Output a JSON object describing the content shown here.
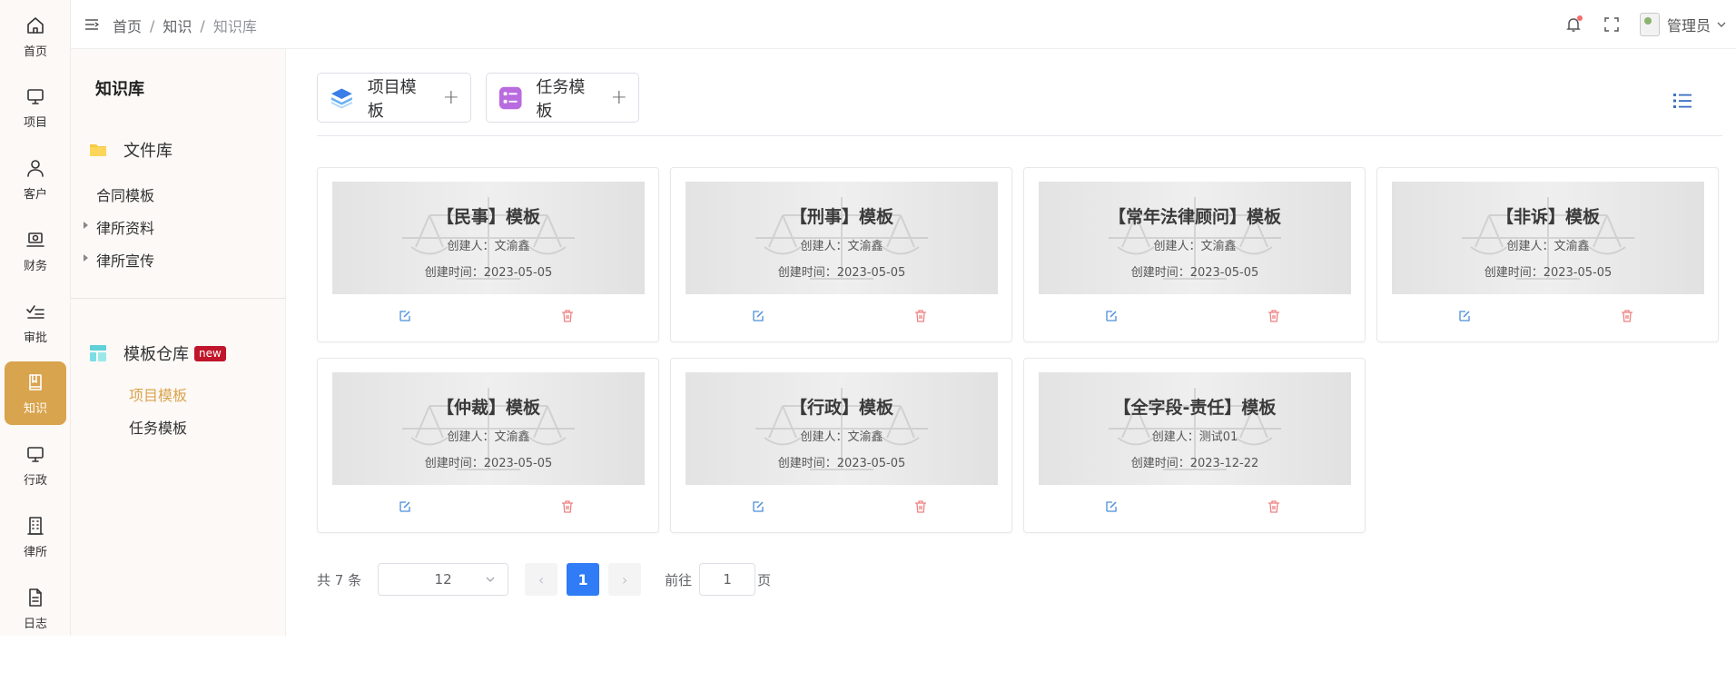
{
  "rail": {
    "items": [
      {
        "label": "首页",
        "icon": "home-icon"
      },
      {
        "label": "项目",
        "icon": "monitor-icon"
      },
      {
        "label": "客户",
        "icon": "user-icon"
      },
      {
        "label": "财务",
        "icon": "finance-icon"
      },
      {
        "label": "审批",
        "icon": "approve-icon"
      },
      {
        "label": "知识",
        "icon": "book-icon",
        "active": true
      },
      {
        "label": "行政",
        "icon": "monitor-icon"
      },
      {
        "label": "律所",
        "icon": "building-icon"
      },
      {
        "label": "日志",
        "icon": "document-icon"
      }
    ],
    "active_color": "#d9a44e"
  },
  "header": {
    "breadcrumbs": [
      "首页",
      "知识",
      "知识库"
    ],
    "separator": "/",
    "user_name": "管理员"
  },
  "sidebar": {
    "title": "知识库",
    "file_library": {
      "label": "文件库",
      "items": [
        {
          "label": "合同模板",
          "expandable": false
        },
        {
          "label": "律所资料",
          "expandable": true
        },
        {
          "label": "律所宣传",
          "expandable": true
        }
      ]
    },
    "template_store": {
      "label": "模板仓库",
      "badge": "new",
      "items": [
        {
          "label": "项目模板",
          "active": true
        },
        {
          "label": "任务模板",
          "active": false
        }
      ]
    }
  },
  "main": {
    "tabs": [
      {
        "label": "项目模板",
        "plus": "+"
      },
      {
        "label": "任务模板",
        "plus": "+"
      }
    ],
    "cards": [
      {
        "name": "【民事】模板",
        "creator": "创建人：文渝鑫",
        "time": "创建时间：2023-05-05"
      },
      {
        "name": "【刑事】模板",
        "creator": "创建人：文渝鑫",
        "time": "创建时间：2023-05-05"
      },
      {
        "name": "【常年法律顾问】模板",
        "creator": "创建人：文渝鑫",
        "time": "创建时间：2023-05-05"
      },
      {
        "name": "【非诉】模板",
        "creator": "创建人：文渝鑫",
        "time": "创建时间：2023-05-05"
      },
      {
        "name": "【仲裁】模板",
        "creator": "创建人：文渝鑫",
        "time": "创建时间：2023-05-05"
      },
      {
        "name": "【行政】模板",
        "creator": "创建人：文渝鑫",
        "time": "创建时间：2023-05-05"
      },
      {
        "name": "【全字段-责任】模板",
        "creator": "创建人：测试01",
        "time": "创建时间：2023-12-22"
      }
    ]
  },
  "pagination": {
    "total_text": "共 7 条",
    "page_size": "12",
    "prev": "‹",
    "next": "›",
    "current_page": "1",
    "goto_label": "前往",
    "goto_value": "1",
    "goto_unit": "页"
  },
  "colors": {
    "accent": "#d9a44e",
    "primary": "#2f7cf6",
    "edit_icon": "#4a8fd9",
    "delete_icon": "#f08080",
    "badge": "#c0152a"
  }
}
